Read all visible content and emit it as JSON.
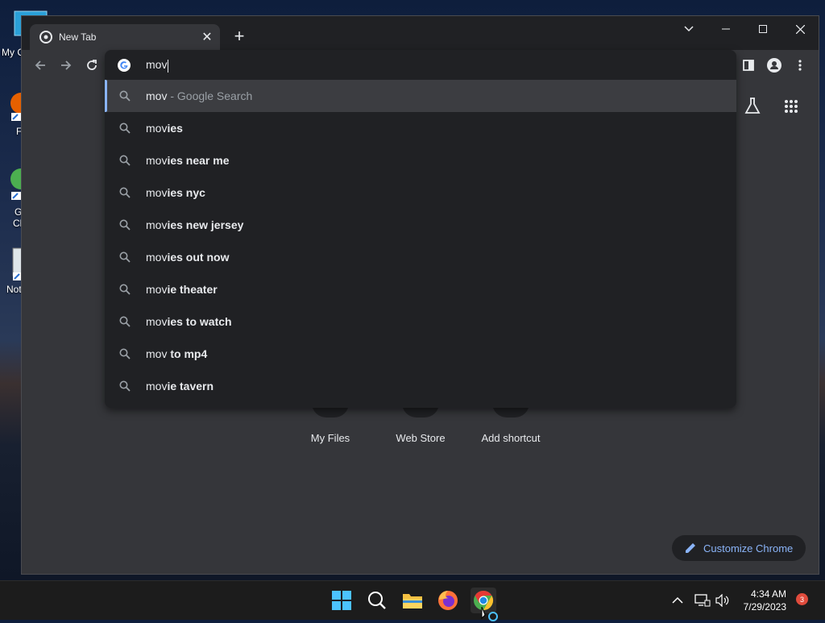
{
  "desktop": {
    "icons": [
      {
        "label": "My C",
        "icon": "computer-icon"
      },
      {
        "label": "F",
        "icon": "firefox-icon"
      },
      {
        "label": "G",
        "icon": "chrome-icon"
      },
      {
        "label": "Cl",
        "icon": "chrome-icon"
      },
      {
        "label": "Not",
        "icon": "notepad-icon"
      }
    ]
  },
  "browser": {
    "tab_title": "New Tab",
    "omnibox": {
      "typed": "mov",
      "suggestions": [
        {
          "prefix": "mov",
          "rest": "",
          "suffix": " - Google Search"
        },
        {
          "prefix": "mov",
          "rest": "ies",
          "suffix": ""
        },
        {
          "prefix": "mov",
          "rest": "ies near me",
          "suffix": ""
        },
        {
          "prefix": "mov",
          "rest": "ies nyc",
          "suffix": ""
        },
        {
          "prefix": "mov",
          "rest": "ies new jersey",
          "suffix": ""
        },
        {
          "prefix": "mov",
          "rest": "ies out now",
          "suffix": ""
        },
        {
          "prefix": "mov",
          "rest": "ie theater",
          "suffix": ""
        },
        {
          "prefix": "mov",
          "rest": "ies to watch",
          "suffix": ""
        },
        {
          "prefix": "mov",
          "rest": " to mp4",
          "suffix": ""
        },
        {
          "prefix": "mov",
          "rest": "ie tavern",
          "suffix": ""
        }
      ]
    },
    "shortcuts": [
      {
        "label": "My Files"
      },
      {
        "label": "Web Store"
      },
      {
        "label": "Add shortcut"
      }
    ],
    "customize_label": "Customize Chrome"
  },
  "taskbar": {
    "time": "4:34 AM",
    "date": "7/29/2023",
    "notification_count": "3"
  },
  "colors": {
    "accent": "#8ab4f8",
    "window_bg": "#35363a",
    "omnibox_bg": "#202124"
  }
}
